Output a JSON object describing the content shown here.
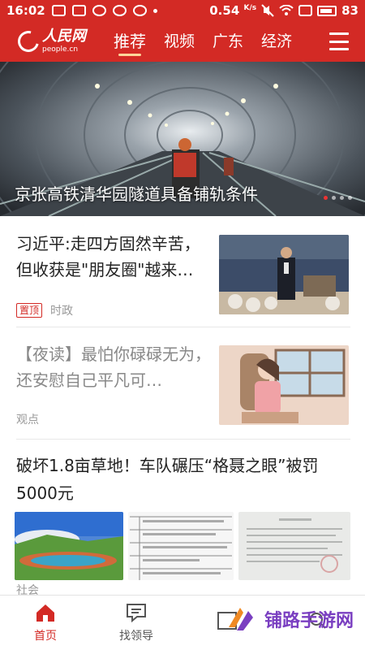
{
  "status_bar": {
    "time": "16:02",
    "net_speed": "0.54",
    "net_unit": "K/s",
    "battery": "83"
  },
  "header": {
    "logo_cn": "人民网",
    "logo_en": "people.cn",
    "tabs": [
      {
        "label": "推荐",
        "active": true
      },
      {
        "label": "视频",
        "active": false
      },
      {
        "label": "广东",
        "active": false
      },
      {
        "label": "经济",
        "active": false
      }
    ],
    "accent_color": "#d32a25"
  },
  "hero": {
    "title": "京张高铁清华园隧道具备铺轨条件"
  },
  "feed": [
    {
      "title": "习近平:走四方固然辛苦，但收获是\"朋友圈\"越来…",
      "badge": "置顶",
      "category": "时政"
    },
    {
      "title": "【夜读】最怕你碌碌无为，还安慰自己平凡可…",
      "category": "观点"
    },
    {
      "title": "破坏1.8亩草地！车队碾压“格聂之眼”被罚5000元",
      "category": "社会"
    }
  ],
  "bottom_nav": {
    "items": [
      {
        "label": "首页",
        "icon": "home-icon",
        "active": true
      },
      {
        "label": "找领导",
        "icon": "message-icon",
        "active": false
      }
    ]
  },
  "watermark": {
    "text": "铺路手游网"
  }
}
